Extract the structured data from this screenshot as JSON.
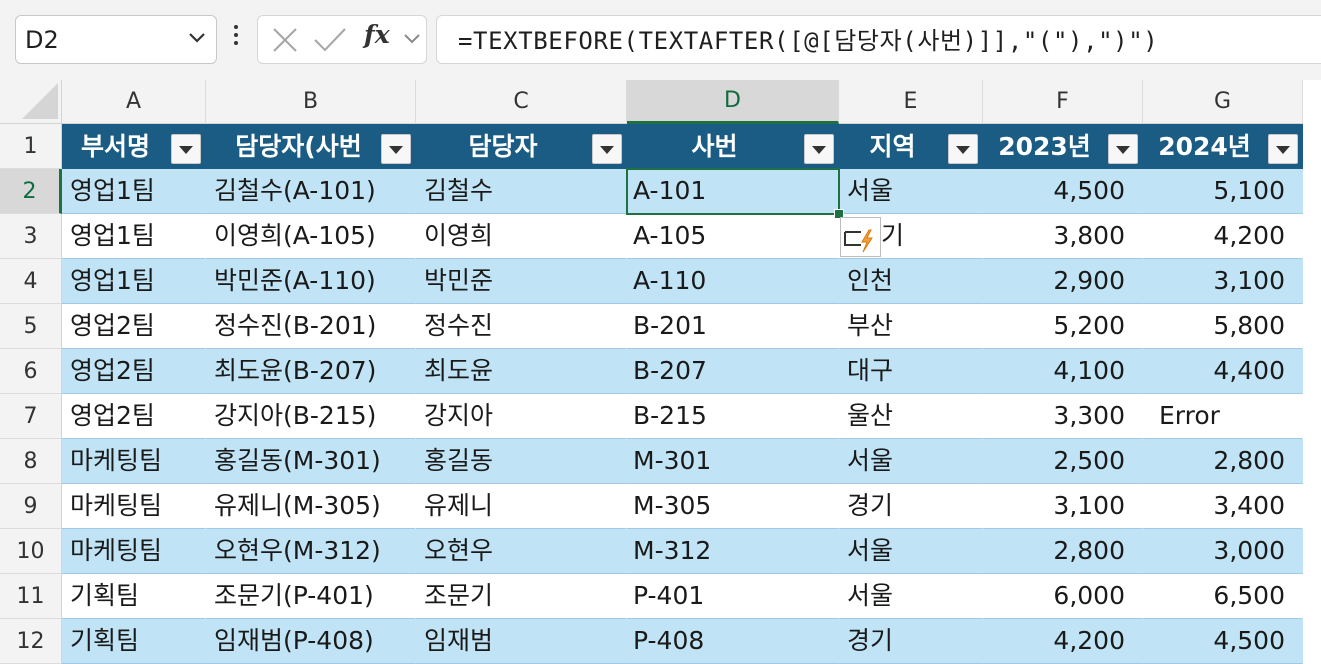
{
  "name_box": {
    "value": "D2"
  },
  "formula_bar": {
    "fx_label": "fx",
    "formula": "=TEXTBEFORE(TEXTAFTER([@[담당자(사번)]],\"(\"),\")\")"
  },
  "columns": [
    "A",
    "B",
    "C",
    "D",
    "E",
    "F",
    "G"
  ],
  "selected_column": "D",
  "table": {
    "headers": [
      "부서명",
      "담당자(사번",
      "담당자",
      "사번",
      "지역",
      "2023년",
      "2024년"
    ],
    "rows": [
      [
        "영업1팀",
        "김철수(A-101)",
        "김철수",
        "A-101",
        "서울",
        "4,500",
        "5,100"
      ],
      [
        "영업1팀",
        "이영희(A-105)",
        "이영희",
        "A-105",
        "기",
        "3,800",
        "4,200"
      ],
      [
        "영업1팀",
        "박민준(A-110)",
        "박민준",
        "A-110",
        "인천",
        "2,900",
        "3,100"
      ],
      [
        "영업2팀",
        "정수진(B-201)",
        "정수진",
        "B-201",
        "부산",
        "5,200",
        "5,800"
      ],
      [
        "영업2팀",
        "최도윤(B-207)",
        "최도윤",
        "B-207",
        "대구",
        "4,100",
        "4,400"
      ],
      [
        "영업2팀",
        "강지아(B-215)",
        "강지아",
        "B-215",
        "울산",
        "3,300",
        "Error"
      ],
      [
        "마케팅팀",
        "홍길동(M-301)",
        "홍길동",
        "M-301",
        "서울",
        "2,500",
        "2,800"
      ],
      [
        "마케팅팀",
        "유제니(M-305)",
        "유제니",
        "M-305",
        "경기",
        "3,100",
        "3,400"
      ],
      [
        "마케팅팀",
        "오현우(M-312)",
        "오현우",
        "M-312",
        "서울",
        "2,800",
        "3,000"
      ],
      [
        "기획팀",
        "조문기(P-401)",
        "조문기",
        "P-401",
        "서울",
        "6,000",
        "6,500"
      ],
      [
        "기획팀",
        "임재범(P-408)",
        "임재범",
        "P-408",
        "경기",
        "4,200",
        "4,500"
      ]
    ]
  },
  "row_numbers": [
    "1",
    "2",
    "3",
    "4",
    "5",
    "6",
    "7",
    "8",
    "9",
    "10",
    "11",
    "12"
  ],
  "colors": {
    "header_fill": "#1b5c84",
    "band_fill": "#c0e4f5",
    "selection": "#1e7145"
  }
}
